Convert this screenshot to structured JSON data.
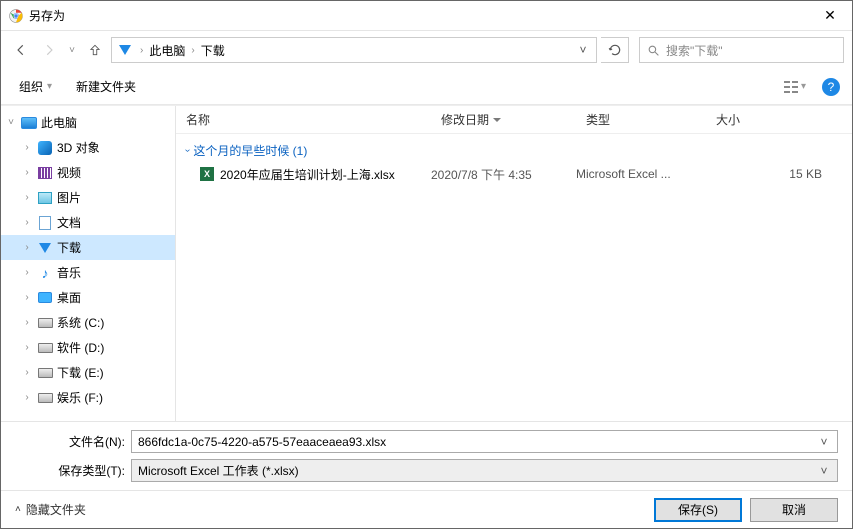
{
  "title": "另存为",
  "nav": {
    "path": [
      "此电脑",
      "下载"
    ],
    "search_placeholder": "搜索\"下载\""
  },
  "toolbar": {
    "organize": "组织",
    "new_folder": "新建文件夹"
  },
  "tree": [
    {
      "label": "此电脑",
      "icon": "pc",
      "expanded": true,
      "indent": 0
    },
    {
      "label": "3D 对象",
      "icon": "3d",
      "indent": 1
    },
    {
      "label": "视频",
      "icon": "video",
      "indent": 1
    },
    {
      "label": "图片",
      "icon": "pic",
      "indent": 1
    },
    {
      "label": "文档",
      "icon": "doc",
      "indent": 1
    },
    {
      "label": "下载",
      "icon": "dl",
      "indent": 1,
      "selected": true
    },
    {
      "label": "音乐",
      "icon": "music",
      "indent": 1
    },
    {
      "label": "桌面",
      "icon": "desk",
      "indent": 1
    },
    {
      "label": "系统 (C:)",
      "icon": "drive",
      "indent": 1
    },
    {
      "label": "软件 (D:)",
      "icon": "drive",
      "indent": 1
    },
    {
      "label": "下载 (E:)",
      "icon": "drive",
      "indent": 1
    },
    {
      "label": "娱乐 (F:)",
      "icon": "drive",
      "indent": 1
    }
  ],
  "columns": {
    "name": "名称",
    "date": "修改日期",
    "type": "类型",
    "size": "大小"
  },
  "group": {
    "label": "这个月的早些时候 (1)"
  },
  "files": [
    {
      "name": "2020年应届生培训计划-上海.xlsx",
      "date": "2020/7/8 下午 4:35",
      "type": "Microsoft Excel ...",
      "size": "15 KB"
    }
  ],
  "form": {
    "filename_label": "文件名(N):",
    "filename_value": "866fdc1a-0c75-4220-a575-57eaaceaea93.xlsx",
    "filetype_label": "保存类型(T):",
    "filetype_value": "Microsoft Excel 工作表 (*.xlsx)"
  },
  "footer": {
    "hide_files": "隐藏文件夹",
    "save": "保存(S)",
    "cancel": "取消"
  }
}
